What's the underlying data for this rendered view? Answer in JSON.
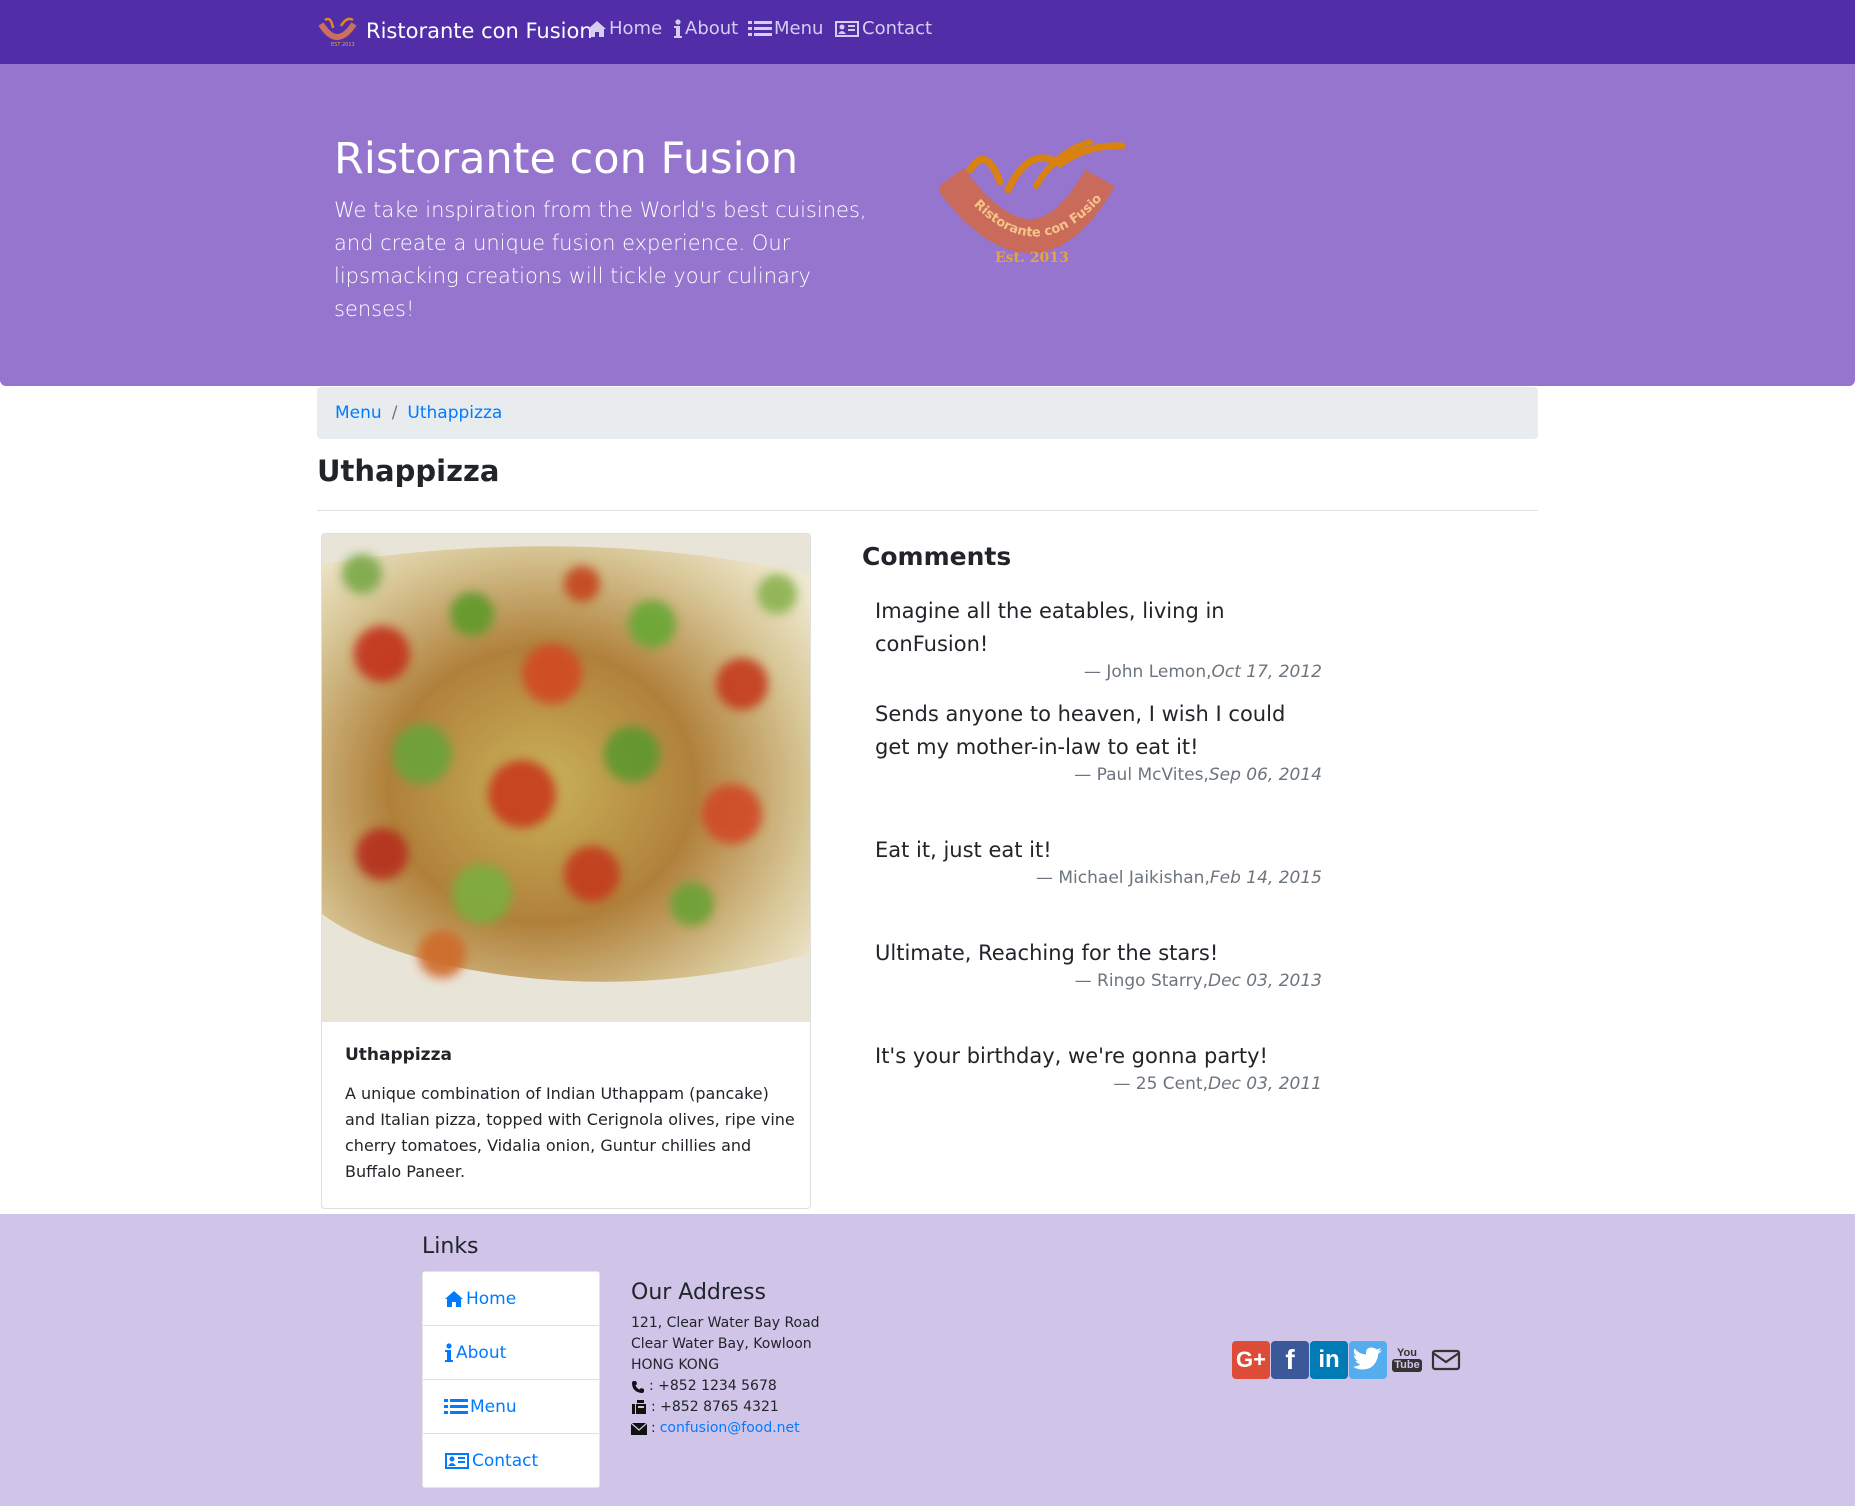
{
  "nav": {
    "brand": "Ristorante con Fusion",
    "items": [
      {
        "label": "Home",
        "icon": "home-icon"
      },
      {
        "label": "About",
        "icon": "info-icon"
      },
      {
        "label": "Menu",
        "icon": "list-icon"
      },
      {
        "label": "Contact",
        "icon": "address-card-icon"
      }
    ]
  },
  "jumbotron": {
    "title": "Ristorante con Fusion",
    "text": "We take inspiration from the World's best cuisines, and create a unique fusion experience. Our lipsmacking creations will tickle your culinary senses!",
    "logo_text": "Ristorante con Fusion",
    "logo_est": "Est. 2013"
  },
  "breadcrumb": [
    "Menu",
    "Uthappizza"
  ],
  "dish": {
    "name": "Uthappizza",
    "description": "A unique combination of Indian Uthappam (pancake) and Italian pizza, topped with Cerignola olives, ripe vine cherry tomatoes, Vidalia onion, Guntur chillies and Buffalo Paneer."
  },
  "comments": {
    "heading": "Comments",
    "items": [
      {
        "text": "Imagine all the eatables, living in conFusion!",
        "author": "— John Lemon,",
        "date": "Oct 17, 2012"
      },
      {
        "text": "Sends anyone to heaven, I wish I could get my mother-in-law to eat it!",
        "author": "— Paul McVites,",
        "date": "Sep 06, 2014"
      },
      {
        "text": "Eat it, just eat it!",
        "author": "— Michael Jaikishan,",
        "date": "Feb 14, 2015"
      },
      {
        "text": "Ultimate, Reaching for the stars!",
        "author": "— Ringo Starry,",
        "date": "Dec 03, 2013"
      },
      {
        "text": "It's your birthday, we're gonna party!",
        "author": "— 25 Cent,",
        "date": "Dec 03, 2011"
      }
    ]
  },
  "footer": {
    "links_heading": "Links",
    "links": [
      "Home",
      "About",
      "Menu",
      "Contact"
    ],
    "address_heading": "Our Address",
    "address_lines": [
      "121, Clear Water Bay Road",
      "Clear Water Bay, Kowloon",
      "HONG KONG"
    ],
    "phone": ": +852 1234 5678",
    "fax": ": +852 8765 4321",
    "email_prefix": ":",
    "email": "confusion@food.net",
    "social": [
      {
        "name": "google-plus",
        "glyph": "G+",
        "color": "#dd4b39"
      },
      {
        "name": "facebook",
        "glyph": "f",
        "color": "#3b5998"
      },
      {
        "name": "linkedin",
        "glyph": "in",
        "color": "#007bb6"
      },
      {
        "name": "twitter",
        "glyph": "t",
        "color": "#55acee"
      },
      {
        "name": "youtube",
        "glyph": "You Tube",
        "color": "#333333"
      },
      {
        "name": "mail",
        "glyph": "",
        "color": "#333333"
      }
    ]
  },
  "colors": {
    "navbar": "#512DA8",
    "jumbotron": "#9575CD",
    "footer": "#D1C4E9",
    "link": "#007bff"
  }
}
